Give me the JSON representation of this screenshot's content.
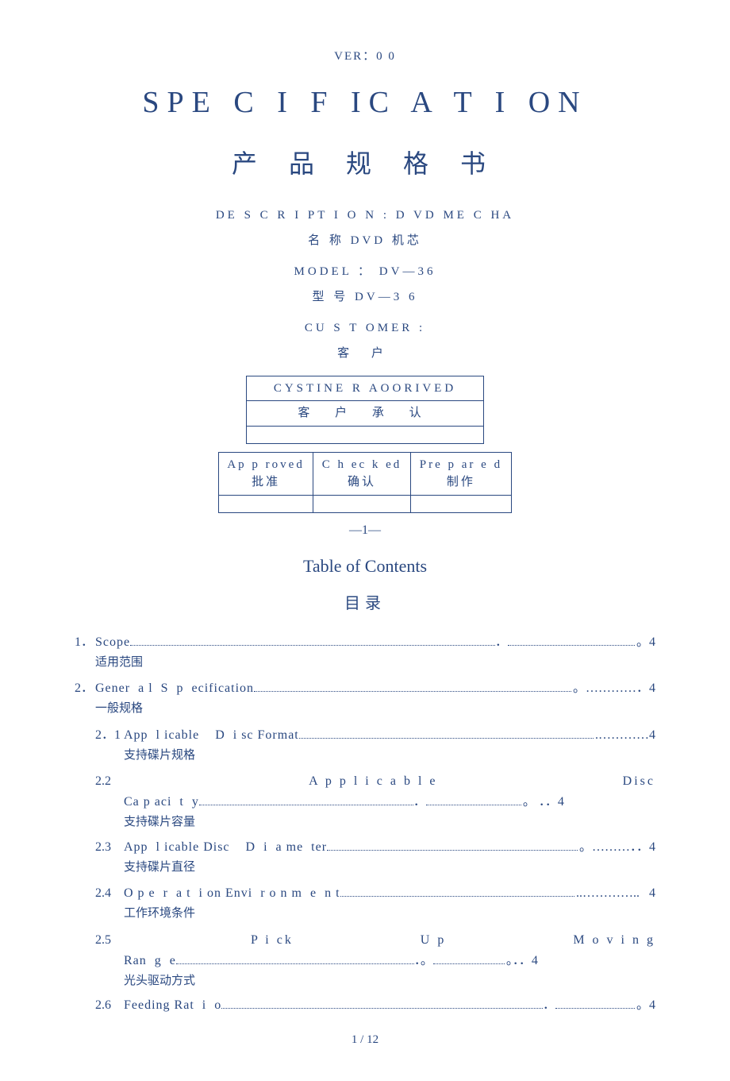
{
  "ver": "VER：0 0",
  "title_en": "SPE C I F IC A  T  I ON",
  "title_cn": "产 品    规 格 书",
  "desc_en": "DE S  C  R  I PT  I  O N :     D VD ME C HA",
  "desc_cn": "名 称      DVD 机芯",
  "model_en": "MODEL      ：         DV—36",
  "model_cn": "型      号      DV—3 6",
  "customer_en": "CU S  T OMER  :",
  "customer_cn": "客  户",
  "approve_table1": {
    "en": "CYSTINE R   AOORIVED",
    "cn": "客    户    承    认"
  },
  "approve_table2": {
    "c1e": "Ap  p  roved",
    "c1c": "批准",
    "c2e": "C  h ec  k  ed",
    "c2c": "确认",
    "c3e": "Pre  p ar  e  d",
    "c3c": "制作"
  },
  "pagebreak": "—1—",
  "toc_en": "Table of Contents",
  "toc_cn": "目录",
  "toc": {
    "i1": {
      "num": "1．",
      "label": "Scope",
      "page": "。4",
      "cn": "适用范围"
    },
    "i2": {
      "num": "2．",
      "label": "Gener  a l  S  p  ecification",
      "page": "。4",
      "cn": "一般规格",
      "s1": {
        "num": "2．1",
        "label": "App  l icable    D  i sc Format",
        "page": "4",
        "cn": "支持碟片规格"
      },
      "s2": {
        "num": "2.2",
        "w1": "A p p l i c a b l e",
        "w2": "Disc",
        "label": "Ca p aci  t  y",
        "page": "。 ．．4",
        "cn": "支持碟片容量"
      },
      "s3": {
        "num": "2.3",
        "label": "App  l icable Disc    D  i  a me  ter",
        "page": "。．．4",
        "cn": "支持碟片直径"
      },
      "s4": {
        "num": "2.4",
        "label": "O p e  r  a t  i on Envi  r o n m  e  n t",
        "page": "  4",
        "cn": "工作环境条件"
      },
      "s5": {
        "num": "2.5",
        "w1": "P  i ck",
        "w2": "U p",
        "w3": "M o v i n g",
        "label": "Ran  g  e",
        "page": "。．．4",
        "cn": "光头驱动方式"
      },
      "s6": {
        "num": "2.6",
        "label": "Feeding Rat  i  o",
        "page": "。4"
      }
    }
  },
  "footer": "1 / 12"
}
